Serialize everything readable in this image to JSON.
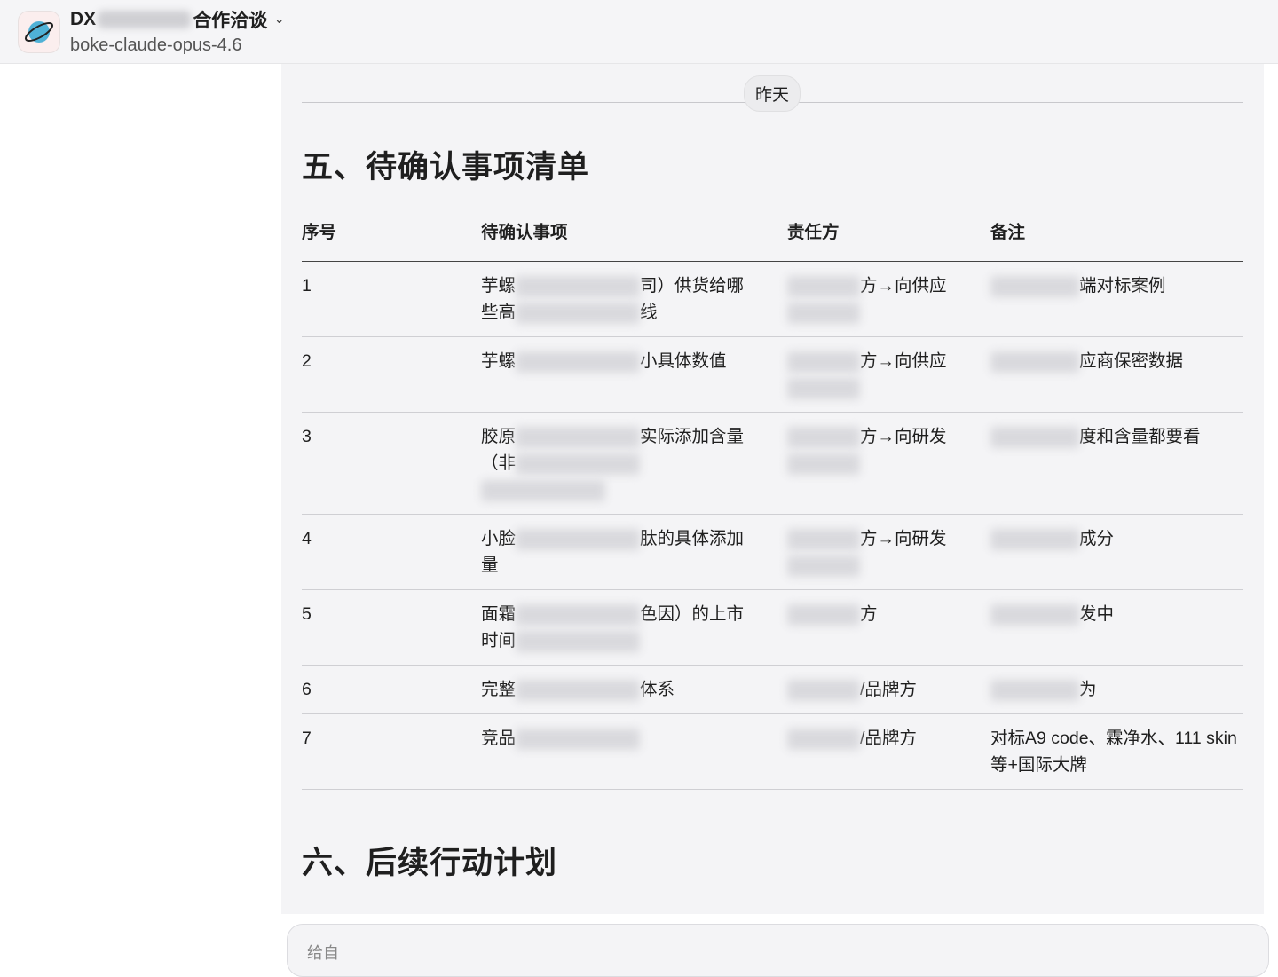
{
  "header": {
    "title_prefix": "DX",
    "title_suffix": "合作洽谈",
    "model": "boke-claude-opus-4.6",
    "chevron": "chevron-down-icon"
  },
  "date_divider": "昨天",
  "section5": {
    "title": "五、待确认事项清单",
    "columns": [
      "序号",
      "待确认事项",
      "责任方",
      "备注"
    ],
    "rows": [
      {
        "no": "1",
        "item": [
          "芋螺",
          "",
          "司）供货给哪些高",
          "",
          "线"
        ],
        "owner": [
          "",
          "方→向供应",
          ""
        ],
        "note": [
          "",
          "端对标案例"
        ]
      },
      {
        "no": "2",
        "item": [
          "芋螺",
          "",
          "小具体数值"
        ],
        "owner": [
          "",
          "方→向供应",
          ""
        ],
        "note": [
          "",
          "应商保密数据"
        ]
      },
      {
        "no": "3",
        "item": [
          "胶原",
          "",
          "实际添加含量（非",
          "",
          ""
        ],
        "owner": [
          "",
          "方→向研发",
          ""
        ],
        "note": [
          "",
          "度和含量都要看"
        ]
      },
      {
        "no": "4",
        "item": [
          "小脸",
          "",
          "肽的具体添加量"
        ],
        "owner": [
          "",
          "方→向研发",
          ""
        ],
        "note": [
          "",
          "成分"
        ]
      },
      {
        "no": "5",
        "item": [
          "面霜",
          "",
          "色因）的上市时间",
          ""
        ],
        "owner": [
          "",
          "方"
        ],
        "note": [
          "",
          "发中"
        ]
      },
      {
        "no": "6",
        "item": [
          "完整",
          "",
          "体系"
        ],
        "owner": [
          "",
          "/品牌方"
        ],
        "note": [
          "",
          "为"
        ]
      },
      {
        "no": "7",
        "item": [
          "竞品",
          ""
        ],
        "owner": [
          "",
          "/品牌方"
        ],
        "note": [
          "对标A9 code、霖净水、111 skin等+国际大牌"
        ]
      }
    ]
  },
  "section6": {
    "title": "六、后续行动计划"
  },
  "input": {
    "placeholder": "给自"
  }
}
